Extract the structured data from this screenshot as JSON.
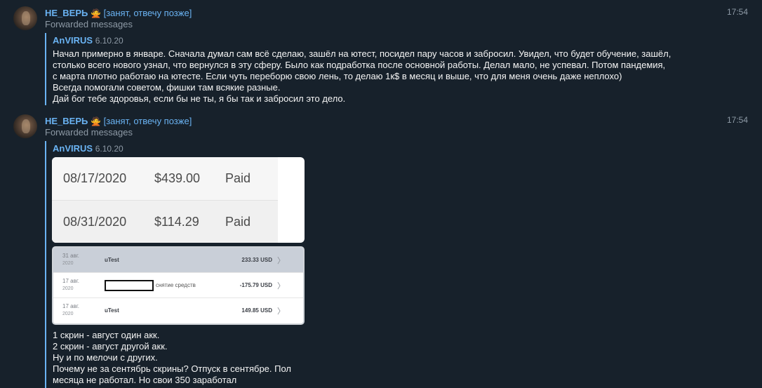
{
  "messages": [
    {
      "author": "НЕ_ВЕРЬ",
      "emoji": "🙅",
      "status": "[занят, отвечу позже]",
      "time": "17:54",
      "forwarded_label": "Forwarded messages",
      "forward_author": "AnVIRUS",
      "forward_date": "6.10.20",
      "lines": [
        "Начал примерно в январе. Сначала думал сам всё сделаю, зашёл на ютест, посидел пару часов и забросил. Увидел, что будет обучение, зашёл,",
        "столько всего нового узнал, что вернулся в эту сферу. Было как подработка после основной работы. Делал мало, не успевал. Потом пандемия,",
        "с марта плотно работаю на ютесте. Если чуть переборю свою лень, то делаю 1к$ в месяц и выше, что для меня очень даже неплохо)",
        "Всегда помогали советом, фишки там всякие разные.",
        "Дай бог тебе здоровья, если бы не ты, я бы так и забросил это дело."
      ]
    },
    {
      "author": "НЕ_ВЕРЬ",
      "emoji": "🙅",
      "status": "[занят, отвечу позже]",
      "time": "17:54",
      "forwarded_label": "Forwarded messages",
      "forward_author": "AnVIRUS",
      "forward_date": "6.10.20",
      "payments": [
        {
          "date": "08/17/2020",
          "amount": "$439.00",
          "status": "Paid"
        },
        {
          "date": "08/31/2020",
          "amount": "$114.29",
          "status": "Paid"
        }
      ],
      "transactions": [
        {
          "day": "31 авг.",
          "year": "2020",
          "payee": "uTest",
          "note": "",
          "amount": "233.33 USD",
          "redacted": false
        },
        {
          "day": "17 авг.",
          "year": "2020",
          "payee": "",
          "note": "снятие средств",
          "amount": "-175.79 USD",
          "redacted": true
        },
        {
          "day": "17 авг.",
          "year": "2020",
          "payee": "uTest",
          "note": "",
          "amount": "149.85 USD",
          "redacted": false
        }
      ],
      "chevron": "〉",
      "lines": [
        "1 скрин - август один акк.",
        "2 скрин - август другой акк.",
        "Ну и по мелочи с других.",
        "Почему не за сентябрь скрины? Отпуск в сентябре. Пол",
        "месяца не работал. Но свои 350 заработал"
      ]
    }
  ]
}
